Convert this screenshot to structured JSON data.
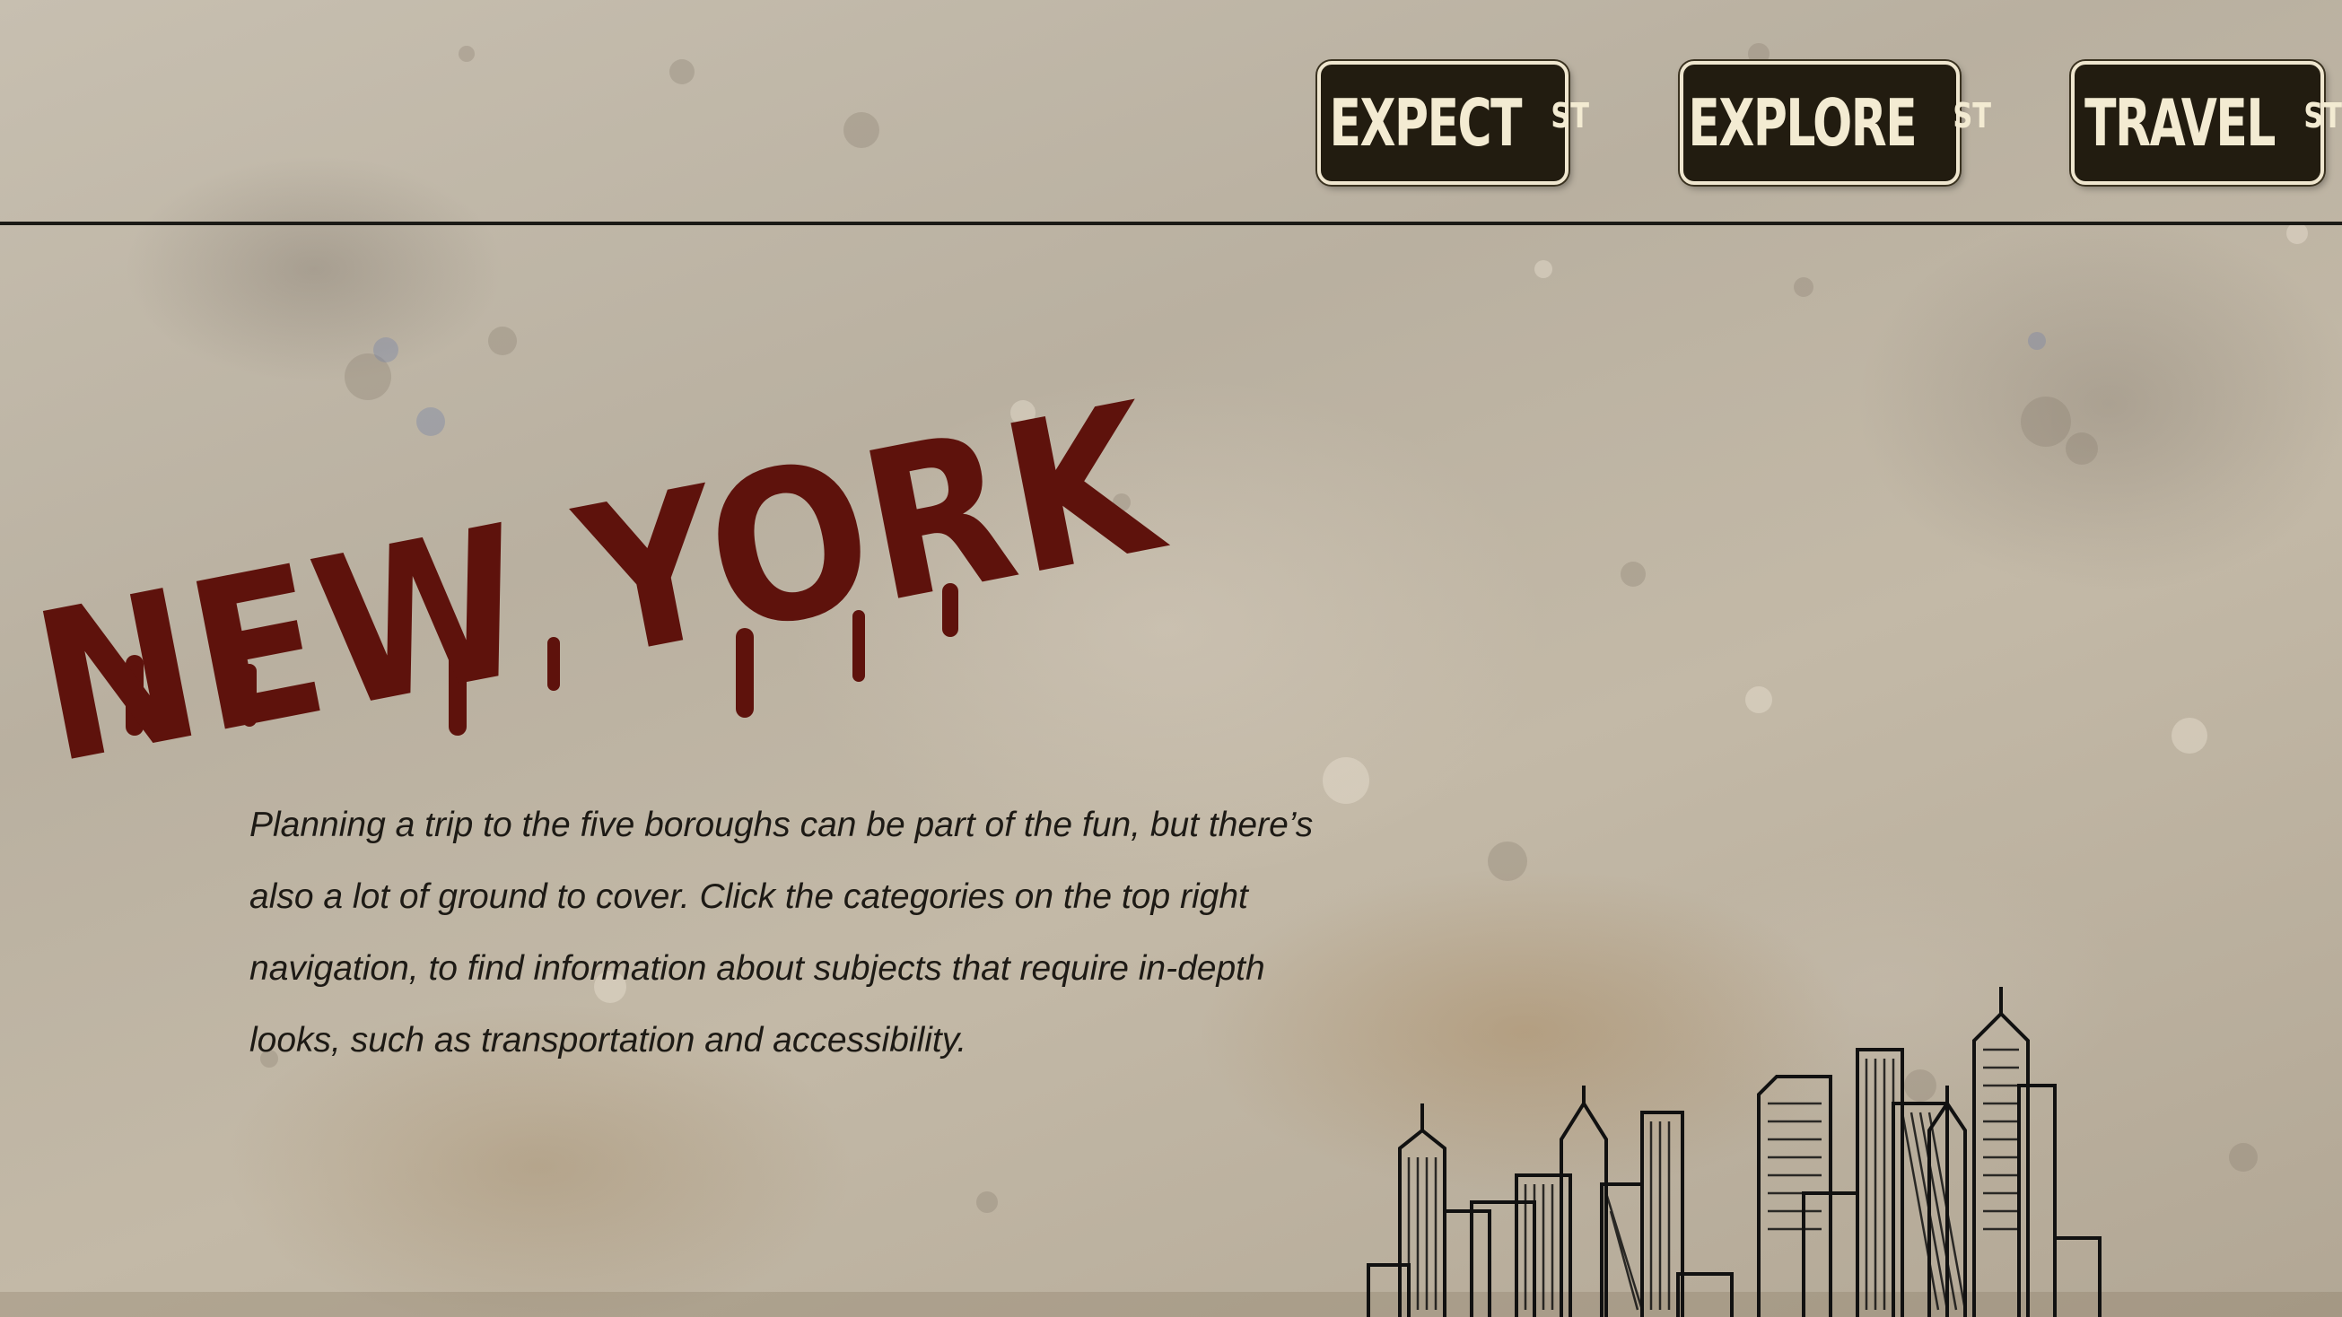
{
  "nav": {
    "items": [
      {
        "label": "EXPECT",
        "suffix": "ST"
      },
      {
        "label": "EXPLORE",
        "suffix": "ST"
      },
      {
        "label": "TRAVEL",
        "suffix": "ST"
      }
    ]
  },
  "hero": {
    "title": "NEW YORK",
    "title_color": "#5e120c",
    "description": "Planning a trip to the five boroughs can be part of the fun, but there’s also a lot of ground to cover. Click the categories on the top right navigation, to find information about subjects that require in-depth looks, such as transportation and accessibility."
  },
  "skyline": {
    "icon": "city-skyline-sketch"
  },
  "colors": {
    "sign_bg": "#221c10",
    "sign_text": "#f3ebd2",
    "background": "#bdb4a4"
  }
}
